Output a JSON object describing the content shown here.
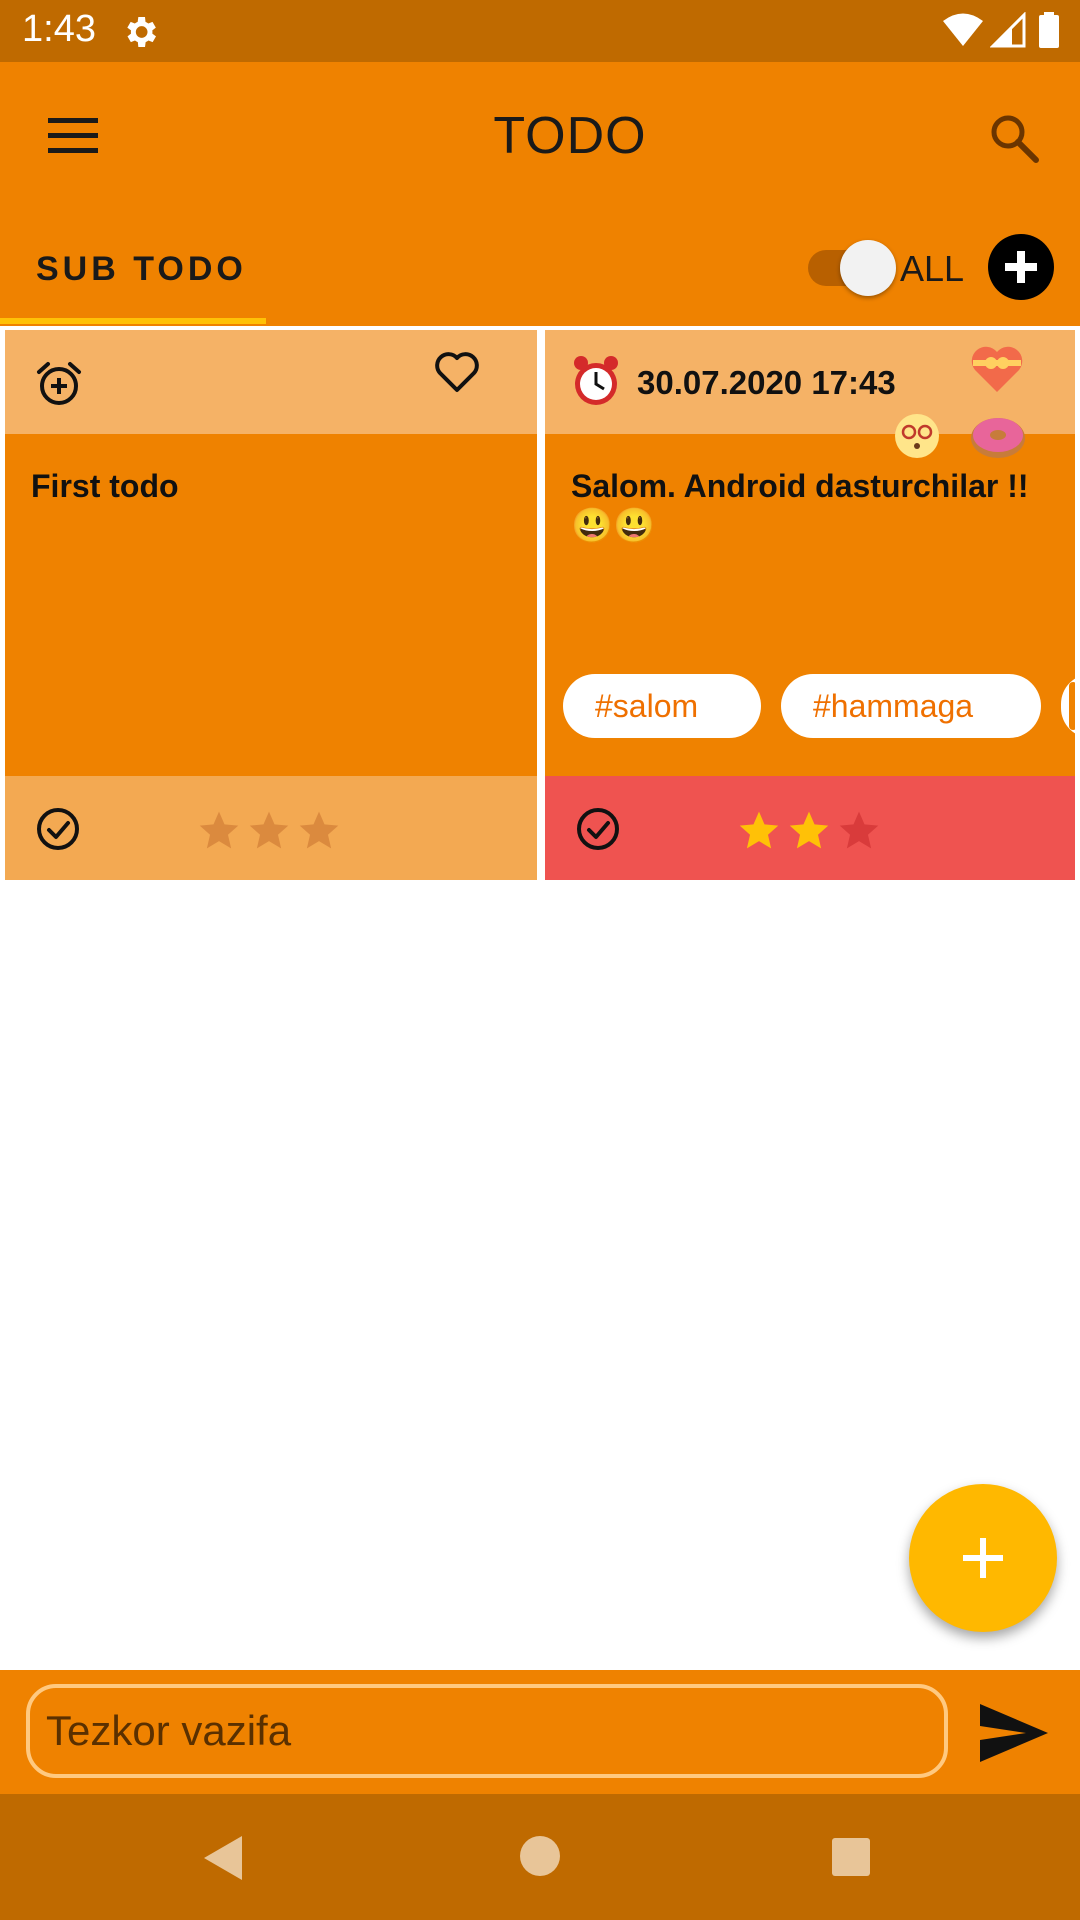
{
  "status_bar": {
    "time": "1:43"
  },
  "app_bar": {
    "title": "TODO"
  },
  "tabs": {
    "sub_todo": "SUB TODO"
  },
  "toggle": {
    "label": "ALL",
    "checked": true
  },
  "cards": [
    {
      "title": "First todo",
      "date": "",
      "rating": 0,
      "tags": []
    },
    {
      "title": "Salom. Android dasturchilar !!",
      "emoji_line": "😃😃",
      "date": "30.07.2020 17:43",
      "rating": 2,
      "tags": [
        "#salom",
        "#hammaga"
      ]
    }
  ],
  "quick_input": {
    "placeholder": "Tezkor vazifa",
    "value": ""
  },
  "colors": {
    "primary": "#EF8200",
    "dark": "#BF6A00",
    "accent": "#FFB800",
    "done_red": "#EF5350"
  }
}
